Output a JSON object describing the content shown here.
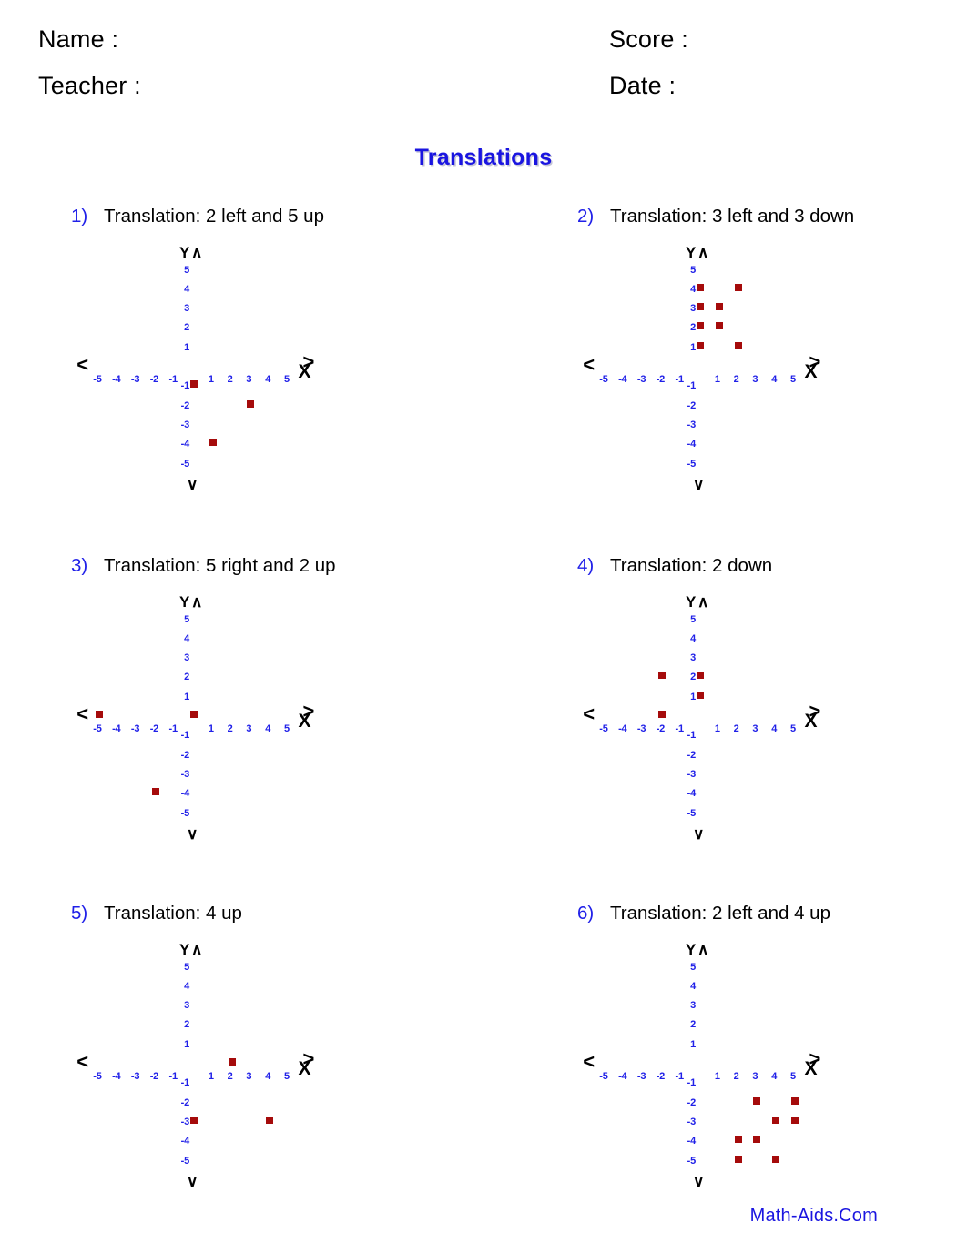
{
  "header": {
    "name_label": "Name :",
    "teacher_label": "Teacher :",
    "score_label": "Score :",
    "date_label": "Date :"
  },
  "title": "Translations",
  "footer": "Math-Aids.Com",
  "colors": {
    "title_blue": "#1a15e0",
    "number_blue": "#2020e8",
    "tick_blue": "#2020e8",
    "point_dark_red": "#a50b0b",
    "text_black": "#000000"
  },
  "axis": {
    "x_label": "X",
    "y_label": "Y",
    "arrow_left": "<",
    "arrow_right": ">",
    "arrow_up": "∧",
    "arrow_down": "∨",
    "x_ticks": [
      "-5",
      "-4",
      "-3",
      "-2",
      "-1",
      "1",
      "2",
      "3",
      "4",
      "5"
    ],
    "y_ticks": [
      "5",
      "4",
      "3",
      "2",
      "1",
      "-1",
      "-2",
      "-3",
      "-4",
      "-5"
    ],
    "x_min": -5,
    "x_max": 5,
    "y_min": -5,
    "y_max": 5
  },
  "problems": [
    {
      "number": "1)",
      "prompt": "Translation: 2 left and 5 up",
      "points": [
        [
          0,
          -1
        ],
        [
          3,
          -2
        ],
        [
          1,
          -4
        ]
      ]
    },
    {
      "number": "2)",
      "prompt": "Translation: 3 left and 3 down",
      "points": [
        [
          0,
          4
        ],
        [
          2,
          4
        ],
        [
          0,
          3
        ],
        [
          1,
          3
        ],
        [
          0,
          2
        ],
        [
          1,
          2
        ],
        [
          0,
          1
        ],
        [
          2,
          1
        ]
      ]
    },
    {
      "number": "3)",
      "prompt": "Translation: 5 right and 2 up",
      "points": [
        [
          -5,
          0
        ],
        [
          0,
          0
        ],
        [
          -2,
          -4
        ]
      ]
    },
    {
      "number": "4)",
      "prompt": "Translation: 2 down",
      "points": [
        [
          -2,
          2
        ],
        [
          0,
          2
        ],
        [
          0,
          1
        ],
        [
          -2,
          0
        ]
      ]
    },
    {
      "number": "5)",
      "prompt": "Translation: 4 up",
      "points": [
        [
          2,
          0
        ],
        [
          0,
          -3
        ],
        [
          4,
          -3
        ]
      ]
    },
    {
      "number": "6)",
      "prompt": "Translation: 2 left and 4 up",
      "points": [
        [
          3,
          -2
        ],
        [
          5,
          -2
        ],
        [
          4,
          -3
        ],
        [
          5,
          -3
        ],
        [
          2,
          -4
        ],
        [
          3,
          -4
        ],
        [
          2,
          -5
        ],
        [
          4,
          -5
        ]
      ]
    }
  ],
  "chart_data": [
    {
      "type": "scatter",
      "title": "1) Translation: 2 left and 5 up",
      "xlabel": "X",
      "ylabel": "Y",
      "xlim": [
        -5,
        5
      ],
      "ylim": [
        -5,
        5
      ],
      "grid": false,
      "legend": false,
      "x": [
        0,
        3,
        1
      ],
      "y": [
        -1,
        -2,
        -4
      ]
    },
    {
      "type": "scatter",
      "title": "2) Translation: 3 left and 3 down",
      "xlabel": "X",
      "ylabel": "Y",
      "xlim": [
        -5,
        5
      ],
      "ylim": [
        -5,
        5
      ],
      "grid": false,
      "legend": false,
      "x": [
        0,
        2,
        0,
        1,
        0,
        1,
        0,
        2
      ],
      "y": [
        4,
        4,
        3,
        3,
        2,
        2,
        1,
        1
      ]
    },
    {
      "type": "scatter",
      "title": "3) Translation: 5 right and 2 up",
      "xlabel": "X",
      "ylabel": "Y",
      "xlim": [
        -5,
        5
      ],
      "ylim": [
        -5,
        5
      ],
      "grid": false,
      "legend": false,
      "x": [
        -5,
        0,
        -2
      ],
      "y": [
        0,
        0,
        -4
      ]
    },
    {
      "type": "scatter",
      "title": "4) Translation: 2 down",
      "xlabel": "X",
      "ylabel": "Y",
      "xlim": [
        -5,
        5
      ],
      "ylim": [
        -5,
        5
      ],
      "grid": false,
      "legend": false,
      "x": [
        -2,
        0,
        0,
        -2
      ],
      "y": [
        2,
        2,
        1,
        0
      ]
    },
    {
      "type": "scatter",
      "title": "5) Translation: 4 up",
      "xlabel": "X",
      "ylabel": "Y",
      "xlim": [
        -5,
        5
      ],
      "ylim": [
        -5,
        5
      ],
      "grid": false,
      "legend": false,
      "x": [
        2,
        0,
        4
      ],
      "y": [
        0,
        -3,
        -3
      ]
    },
    {
      "type": "scatter",
      "title": "6) Translation: 2 left and 4 up",
      "xlabel": "X",
      "ylabel": "Y",
      "xlim": [
        -5,
        5
      ],
      "ylim": [
        -5,
        5
      ],
      "grid": false,
      "legend": false,
      "x": [
        3,
        5,
        4,
        5,
        2,
        3,
        2,
        4
      ],
      "y": [
        -2,
        -2,
        -3,
        -3,
        -4,
        -4,
        -5,
        -5
      ]
    }
  ]
}
